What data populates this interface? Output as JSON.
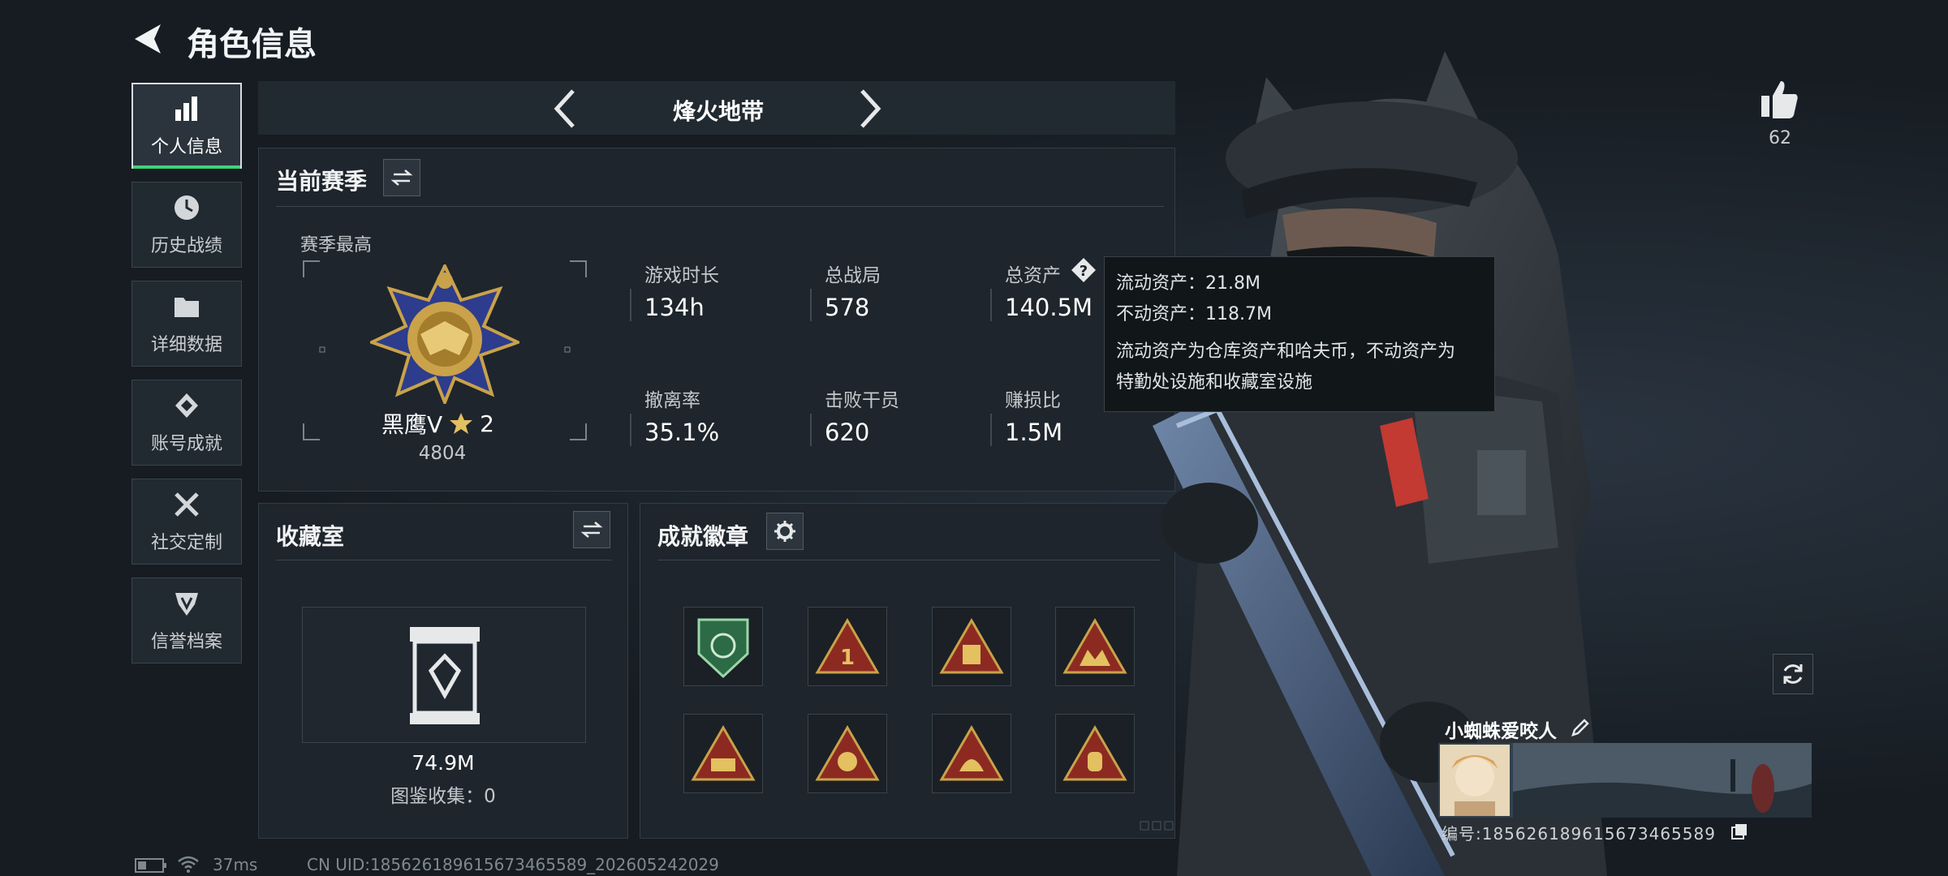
{
  "header": {
    "title": "角色信息"
  },
  "sidebar": {
    "items": [
      {
        "label": "个人信息",
        "icon": "bar-chart-icon",
        "active": true
      },
      {
        "label": "历史战绩",
        "icon": "clock-icon"
      },
      {
        "label": "详细数据",
        "icon": "folder-icon"
      },
      {
        "label": "账号成就",
        "icon": "trophy-icon"
      },
      {
        "label": "社交定制",
        "icon": "tools-icon"
      },
      {
        "label": "信誉档案",
        "icon": "shield-icon"
      }
    ]
  },
  "mode": {
    "title": "烽火地带"
  },
  "season": {
    "title": "当前赛季",
    "best_label": "赛季最高",
    "rank_name": "黑鹰Ⅴ",
    "rank_stars": "2",
    "rank_score": "4804",
    "stats": [
      {
        "label": "游戏时长",
        "value": "134h"
      },
      {
        "label": "总战局",
        "value": "578"
      },
      {
        "label": "总资产",
        "value": "140.5M"
      },
      {
        "label": "撤离率",
        "value": "35.1%"
      },
      {
        "label": "击败干员",
        "value": "620"
      },
      {
        "label": "赚损比",
        "value": "1.5M"
      }
    ]
  },
  "tooltip": {
    "line1": "流动资产：21.8M",
    "line2": "不动资产：118.7M",
    "line3": "流动资产为仓库资产和哈夫币，不动资产为",
    "line4": "特勤处设施和收藏室设施"
  },
  "collection": {
    "title": "收藏室",
    "value": "74.9M",
    "catalog": "图鉴收集：0"
  },
  "achievements": {
    "title": "成就徽章"
  },
  "profile": {
    "likes": "62",
    "name": "小蜘蛛爱咬人",
    "uid_line": "编号:1856261896156734655​89"
  },
  "status_bar": {
    "ping": "37ms",
    "uid": "CN UID:185626189615673465589_202605242029"
  },
  "colors": {
    "accent_green": "#3fd37a",
    "gold": "#c9a24a",
    "badge_red": "#8c2a22"
  }
}
